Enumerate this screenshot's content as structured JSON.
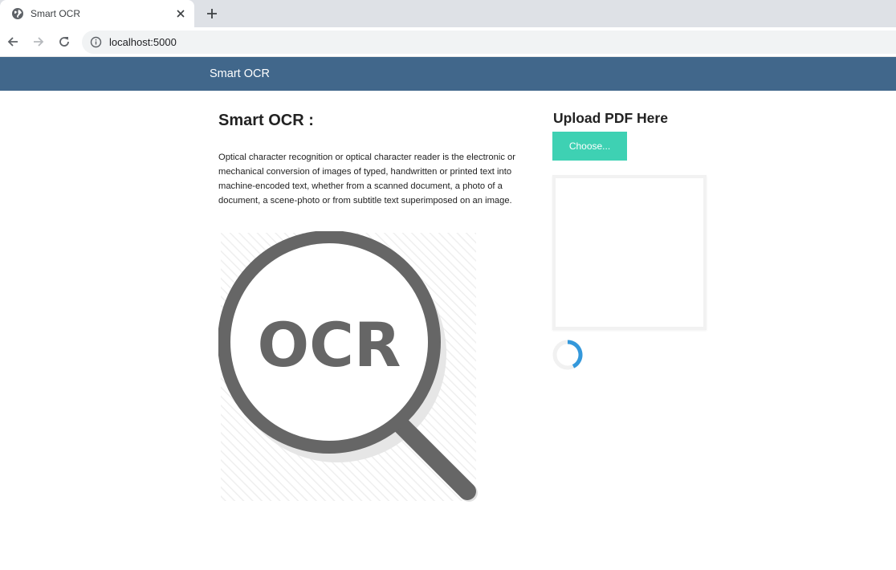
{
  "browser": {
    "tab_title": "Smart OCR",
    "url": "localhost:5000"
  },
  "navbar": {
    "brand": "Smart OCR"
  },
  "main": {
    "title": "Smart OCR :",
    "description": "Optical character recognition or optical character reader is the electronic or mechanical conversion of images of typed, handwritten or printed text into machine-encoded text, whether from a scanned document, a photo of a document, a scene-photo or from subtitle text superimposed on an image.",
    "image_text": "OCR"
  },
  "upload": {
    "heading": "Upload PDF Here",
    "choose_label": "Choose..."
  },
  "colors": {
    "navbar": "#41678b",
    "choose_button": "#3ed1b3",
    "spinner": "#3498db"
  }
}
